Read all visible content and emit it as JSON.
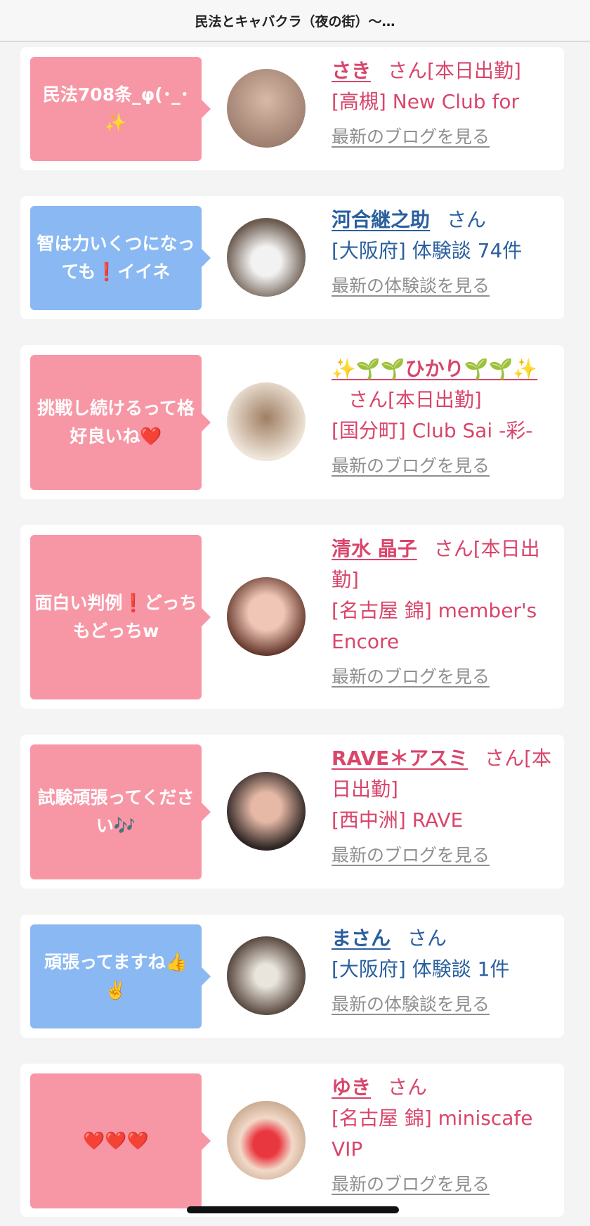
{
  "header": {
    "title": "民法とキャバクラ（夜の街）〜…"
  },
  "cards": [
    {
      "comment": "民法708条_φ(･_･✨",
      "name": "さき",
      "san": "さん[本日出勤]",
      "store": "[高槻] New Club for",
      "link": "最新のブログを見る"
    },
    {
      "comment": "智は力いくつになっても❗️イイネ",
      "name": "河合継之助",
      "san": "さん",
      "store": "[大阪府] 体験談 74件",
      "link": "最新の体験談を見る"
    },
    {
      "comment": "挑戦し続けるって格好良いね❤️",
      "name": "✨🌱🌱ひかり🌱🌱✨",
      "san": "さん[本日出勤]",
      "store": "[国分町] Club Sai -彩-",
      "link": "最新のブログを見る"
    },
    {
      "comment": "面白い判例❗️どっちもどっちw",
      "name": "清水 晶子",
      "san": "さん[本日出勤]",
      "store": "[名古屋 錦] member's Encore",
      "link": "最新のブログを見る"
    },
    {
      "comment": "試験頑張ってください🎶",
      "name": "RAVE＊アスミ",
      "san": "さん[本日出勤]",
      "store": "[西中洲] RAVE",
      "link": "最新のブログを見る"
    },
    {
      "comment": "頑張ってますね👍✌️",
      "name": "まさん",
      "san": "さん",
      "store": "[大阪府] 体験談 1件",
      "link": "最新の体験談を見る"
    },
    {
      "comment": "❤️❤️❤️",
      "name": "ゆき",
      "san": "さん",
      "store": "[名古屋 錦] miniscafe VIP",
      "link": "最新のブログを見る"
    }
  ]
}
